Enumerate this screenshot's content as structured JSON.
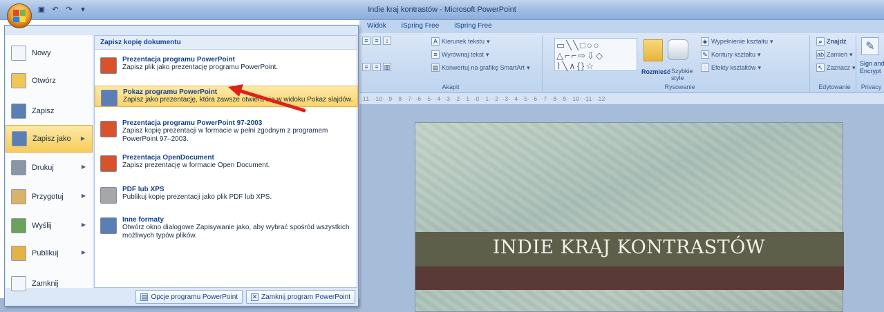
{
  "window": {
    "title": "Indie kraj kontrastów - Microsoft PowerPoint"
  },
  "ribbon": {
    "tabs": [
      "Widok",
      "iSpring Free",
      "iSpring Free"
    ],
    "paragraph": {
      "text_direction": "Kierunek tekstu",
      "align_text": "Wyrównaj tekst",
      "convert_smartart": "Konwertuj na grafikę SmartArt",
      "label": "Akapit"
    },
    "drawing": {
      "arrange": "Rozmieść",
      "quick_styles": "Szybkie style",
      "shape_fill": "Wypełnienie kształtu",
      "shape_outline": "Kontury kształtu",
      "shape_effects": "Efekty kształtów",
      "label": "Rysowanie"
    },
    "editing": {
      "find": "Znajdź",
      "replace": "Zamień",
      "select": "Zaznacz",
      "label": "Edytowanie"
    },
    "privacy": {
      "sign_and": "Sign and",
      "encrypt": "Encrypt",
      "label": "Privacy"
    }
  },
  "ruler": "·11· ·10· ·9· ·8· ·7· ·6· ·5· ·4· ·3· ·2· ·1· ·0· ·1· ·2· ·3· ·4· ·5· ·6· ·7· ·8· ·9· ·10· ·11· ·12·",
  "slide": {
    "title": "INDIE KRAJ KONTRASTÓW"
  },
  "menu": {
    "left_items": [
      {
        "label": "Nowy",
        "has_arrow": false,
        "color": "#f4f6fb"
      },
      {
        "label": "Otwórz",
        "has_arrow": false,
        "color": "#f0c659"
      },
      {
        "label": "Zapisz",
        "has_arrow": false,
        "color": "#5b7fb5"
      },
      {
        "label": "Zapisz jako",
        "has_arrow": true,
        "color": "#5b7fb5"
      },
      {
        "label": "Drukuj",
        "has_arrow": true,
        "color": "#8c95a3"
      },
      {
        "label": "Przygotuj",
        "has_arrow": true,
        "color": "#d8b46a"
      },
      {
        "label": "Wyślij",
        "has_arrow": true,
        "color": "#6da25a"
      },
      {
        "label": "Publikuj",
        "has_arrow": true,
        "color": "#e3b34a"
      },
      {
        "label": "Zamknij",
        "has_arrow": false,
        "color": "#f4f6fb"
      }
    ],
    "right_header": "Zapisz kopię dokumentu",
    "options": [
      {
        "title": "Prezentacja programu PowerPoint",
        "desc": "Zapisz plik jako prezentację programu PowerPoint.",
        "color": "#d9522a"
      },
      {
        "title": "Pokaz programu PowerPoint",
        "desc": "Zapisz jako prezentację, która zawsze otwiera się w widoku Pokaz slajdów.",
        "color": "#5b7fb5"
      },
      {
        "title": "Prezentacja programu PowerPoint 97-2003",
        "desc": "Zapisz kopię prezentacji w formacie w pełni zgodnym z programem PowerPoint 97–2003.",
        "color": "#d9522a"
      },
      {
        "title": "Prezentacja OpenDocument",
        "desc": "Zapisz prezentację w formacie Open Document.",
        "color": "#d9522a"
      },
      {
        "title": "PDF lub XPS",
        "desc": "Publikuj kopię prezentacji jako plik PDF lub XPS.",
        "color": "#a7a7a7"
      },
      {
        "title": "Inne formaty",
        "desc": "Otwórz okno dialogowe Zapisywanie jako, aby wybrać spośród wszystkich możliwych typów plików.",
        "color": "#5b7fb5"
      }
    ],
    "options_button": "Opcje programu PowerPoint",
    "exit_button": "Zamknij program PowerPoint"
  },
  "colors": {
    "accent": "#15428b",
    "highlight": "#f7cc57",
    "arrow": "#e0211a"
  }
}
